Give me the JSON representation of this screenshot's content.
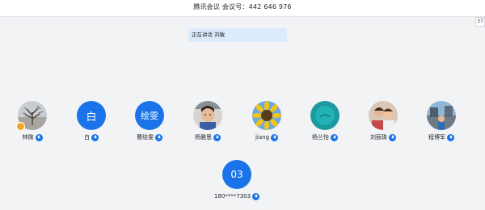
{
  "window": {
    "title": "腾讯会议 会议号：442 646 976",
    "counter": "37"
  },
  "notice": {
    "text": "正在讲话 刘敏"
  },
  "participants": [
    {
      "name": "林微",
      "avatar_text": "",
      "avatar": "tree-photo"
    },
    {
      "name": "白",
      "avatar_text": "白",
      "avatar": "initial"
    },
    {
      "name": "曹绘雯",
      "avatar_text": "绘雯",
      "avatar": "initial"
    },
    {
      "name": "杨雅思",
      "avatar_text": "",
      "avatar": "child-photo"
    },
    {
      "name": "jiang",
      "avatar_text": "",
      "avatar": "sunflower-photo"
    },
    {
      "name": "杨兰怡",
      "avatar_text": "",
      "avatar": "teal-photo"
    },
    {
      "name": "刘丽珠",
      "avatar_text": "",
      "avatar": "family-photo"
    },
    {
      "name": "程博军",
      "avatar_text": "",
      "avatar": "street-photo"
    },
    {
      "name": "180****7303",
      "avatar_text": "03",
      "avatar": "initial"
    }
  ],
  "colors": {
    "accent": "#1a73e8",
    "background": "#f2f3f5",
    "notice_bg": "#dcebfb"
  }
}
